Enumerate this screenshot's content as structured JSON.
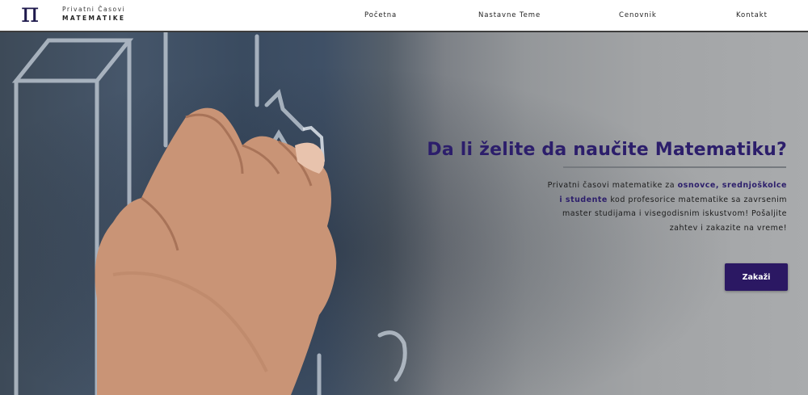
{
  "logo": {
    "symbol": "π",
    "line1": "Privatni Časovi",
    "line2": "MATEMATIKE"
  },
  "nav": {
    "items": [
      {
        "label": "Početna"
      },
      {
        "label": "Nastavne Teme"
      },
      {
        "label": "Cenovnik"
      },
      {
        "label": "Kontakt"
      }
    ]
  },
  "hero": {
    "headline": "Da li želite da naučite Matematiku?",
    "text_before": "Privatni časovi matematike za ",
    "highlight": "osnovce, srednjoškolce i studente",
    "text_after": " kod profesorice matematike sa zavrsenim master studijama i visegodisnim iskustvom! Pošaljite zahtev i zakazite na vreme!",
    "cta_label": "Zakaži"
  },
  "colors": {
    "brand": "#2b1863",
    "headline": "#2c1e6b"
  },
  "icons": {
    "logo": "pi-icon"
  }
}
